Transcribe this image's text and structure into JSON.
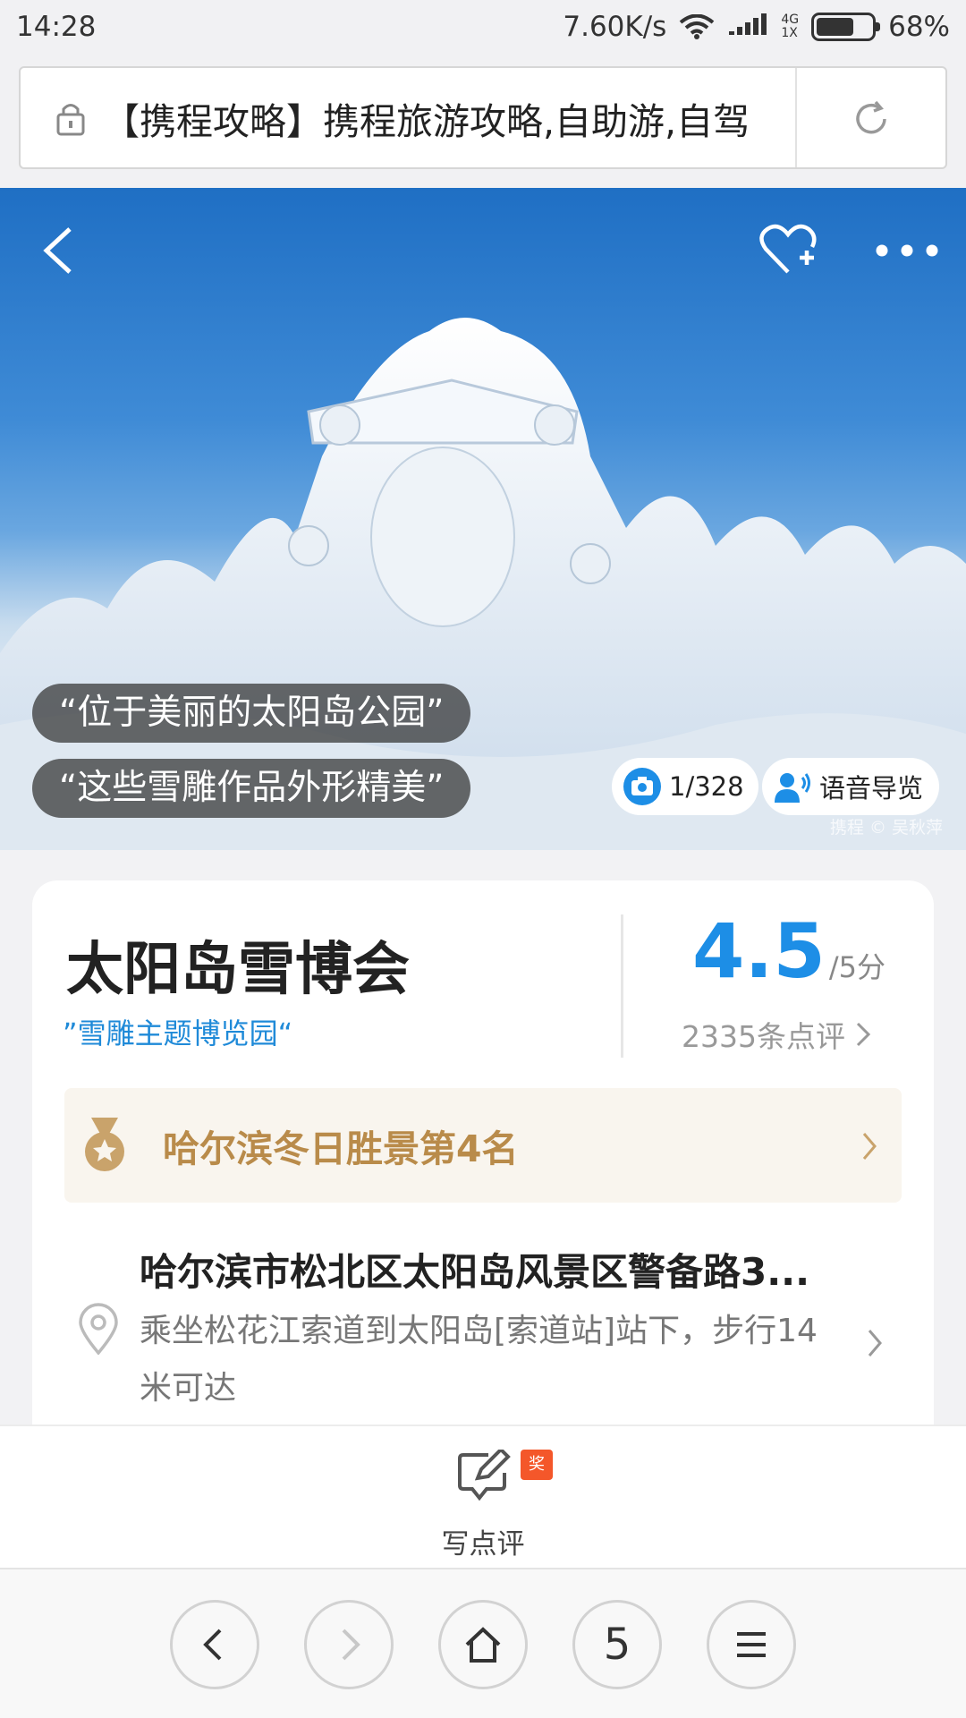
{
  "status_bar": {
    "time": "14:28",
    "net_speed": "7.60K/s",
    "net_type_top": "4G",
    "net_type_bottom": "1X",
    "battery": "68%",
    "battery_level": 0.68
  },
  "browser": {
    "url_title": "【携程攻略】携程旅游攻略,自助游,自驾",
    "lock_icon": "lock-icon",
    "reload_icon": "reload-icon"
  },
  "hero": {
    "quotes": [
      "“位于美丽的太阳岛公园”",
      "“这些雪雕作品外形精美”"
    ],
    "photo_count": "1/328",
    "audio_guide": "语音导览",
    "watermark": "携程 © 吴秋萍"
  },
  "attraction": {
    "title": "太阳岛雪博会",
    "subtitle": "”雪雕主题博览园“",
    "rating": "4.5",
    "rating_scale": "/5分",
    "review_count": "2335条点评",
    "ranking": "哈尔滨冬日胜景第4名",
    "address": "哈尔滨市松北区太阳岛风景区警备路3...",
    "transit": "乘坐松花江索道到太阳岛[索道站]站下，步行14米可达"
  },
  "review_bar": {
    "label": "写点评",
    "badge": "奖"
  },
  "nav": {
    "tab_count": "5"
  },
  "colors": {
    "accent_blue": "#1d8ee6",
    "rank_gold": "#b98b4a",
    "badge_red": "#f4572a"
  }
}
